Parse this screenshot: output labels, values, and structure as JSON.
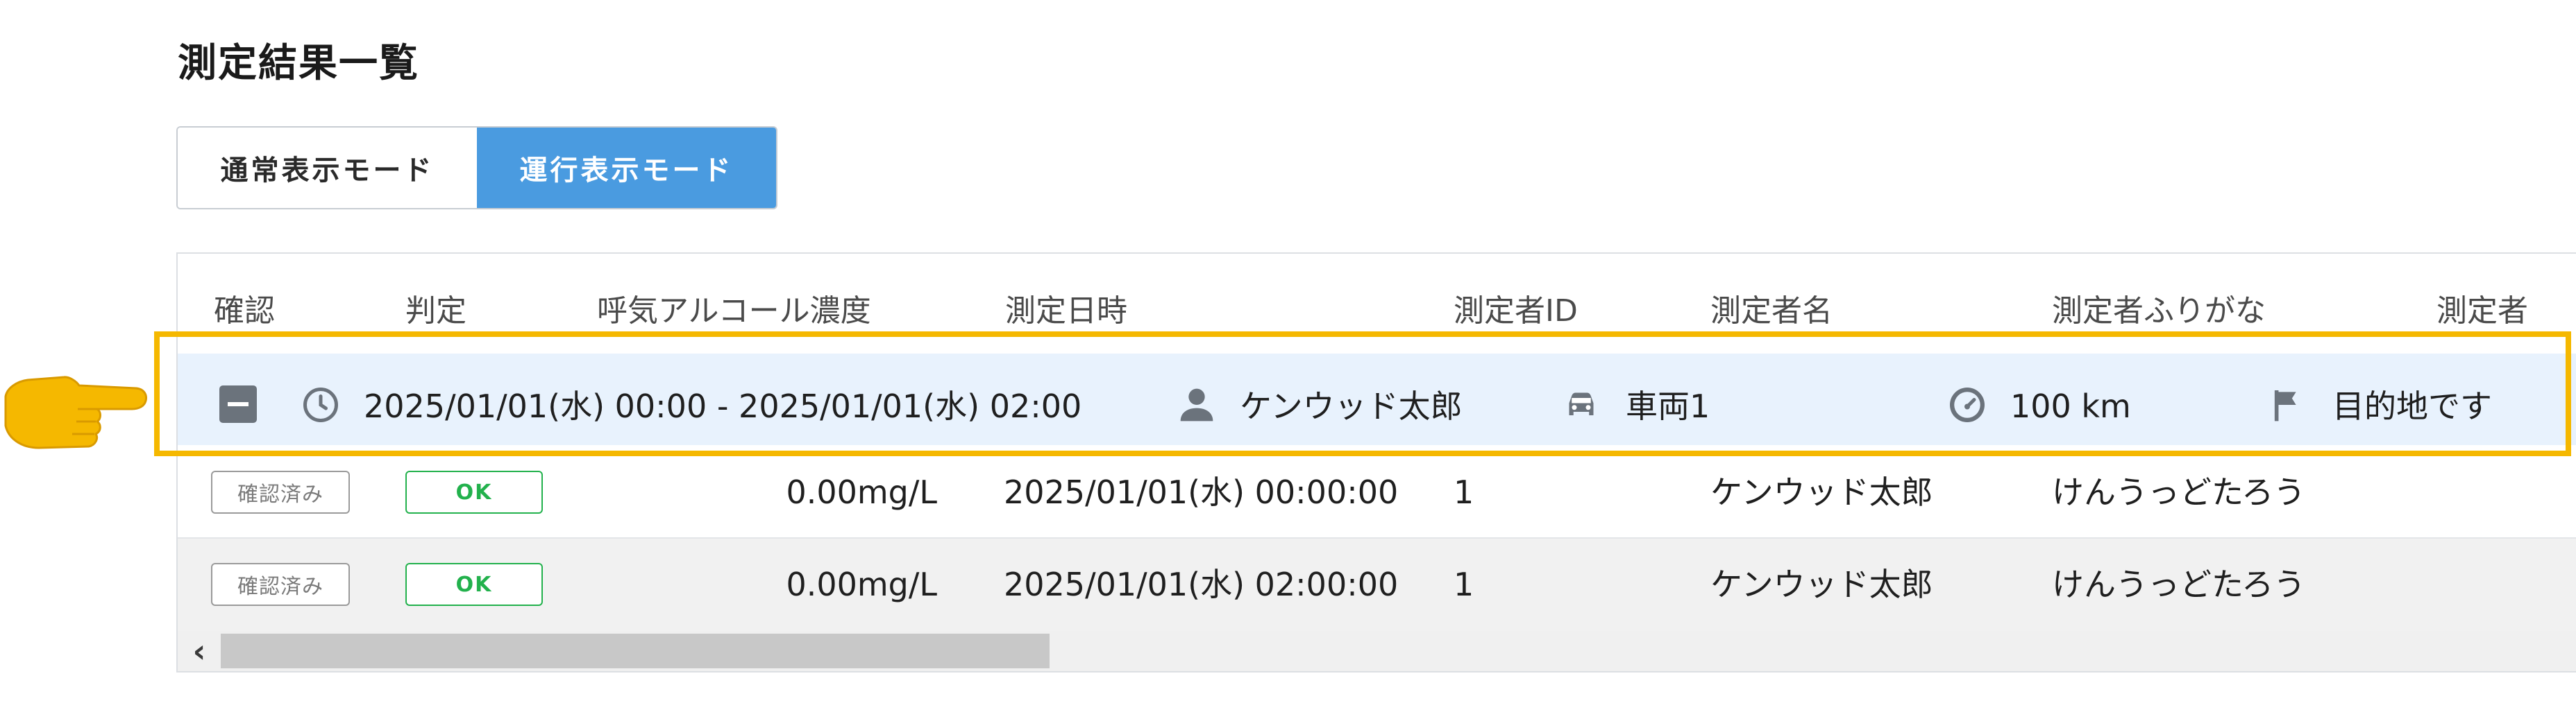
{
  "page": {
    "title": "測定結果一覧"
  },
  "mode_toggle": {
    "normal_label": "通常表示モード",
    "trip_label": "運行表示モード",
    "active": "trip"
  },
  "table": {
    "columns": [
      "確認",
      "判定",
      "呼気アルコール濃度",
      "測定日時",
      "測定者ID",
      "測定者名",
      "測定者ふりがな",
      "測定者"
    ],
    "group": {
      "period": "2025/01/01(水) 00:00 - 2025/01/01(水) 02:00",
      "driver": "ケンウッド太郎",
      "vehicle": "車両1",
      "distance": "100 km",
      "destination": "目的地です"
    },
    "rows": [
      {
        "status": "確認済み",
        "judgement": "OK",
        "alcohol": "0.00mg/L",
        "datetime": "2025/01/01(水) 00:00:00",
        "id": "1",
        "name": "ケンウッド太郎",
        "furigana": "けんうっどたろう"
      },
      {
        "status": "確認済み",
        "judgement": "OK",
        "alcohol": "0.00mg/L",
        "datetime": "2025/01/01(水) 02:00:00",
        "id": "1",
        "name": "ケンウッド太郎",
        "furigana": "けんうっどたろう"
      }
    ]
  },
  "icons": {
    "collapse": "minus-square-icon",
    "period": "clock-icon",
    "driver": "person-icon",
    "vehicle": "car-icon",
    "distance": "speedometer-icon",
    "destination": "flag-icon",
    "scroll_left": "chevron-left-icon",
    "annotation": "pointing-hand-icon"
  },
  "colors": {
    "active_mode": "#4a9be0",
    "group_row": "#e8f2fd",
    "ok_green": "#22b14c",
    "highlight": "#f5b800"
  }
}
